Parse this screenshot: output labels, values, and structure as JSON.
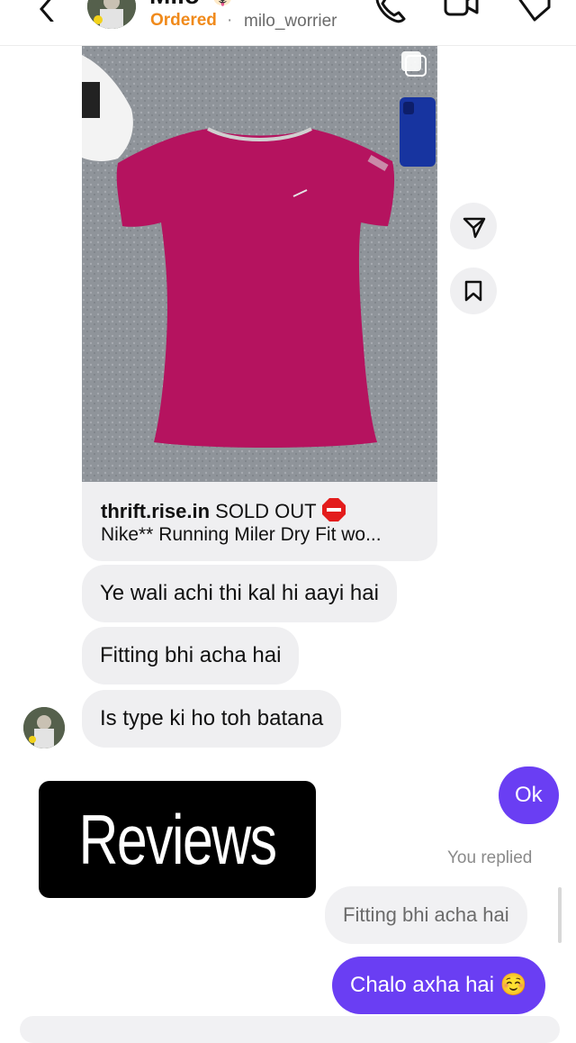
{
  "header": {
    "name": "Milo 🐶",
    "status": "Ordered",
    "separator": "·",
    "username": "milo_worrier"
  },
  "post": {
    "shop": "thrift.rise.in",
    "sold_out": "SOLD OUT",
    "description": "Nike** Running Miler Dry Fit wo...",
    "product_color": "#b5135f"
  },
  "messages": {
    "m1": "Ye wali achi thi kal hi aayi hai",
    "m2": "Fitting bhi acha hai",
    "m3": "Is type ki ho toh batana",
    "out1": "Ok",
    "replied_label": "You replied",
    "quote": "Fitting bhi acha hai",
    "out2": "Chalo axha hai ☺️"
  },
  "overlay": {
    "reviews": "Reviews"
  },
  "colors": {
    "accent": "#6a3ef3",
    "status": "#f08a1b",
    "bubble_in": "#efeff1"
  }
}
